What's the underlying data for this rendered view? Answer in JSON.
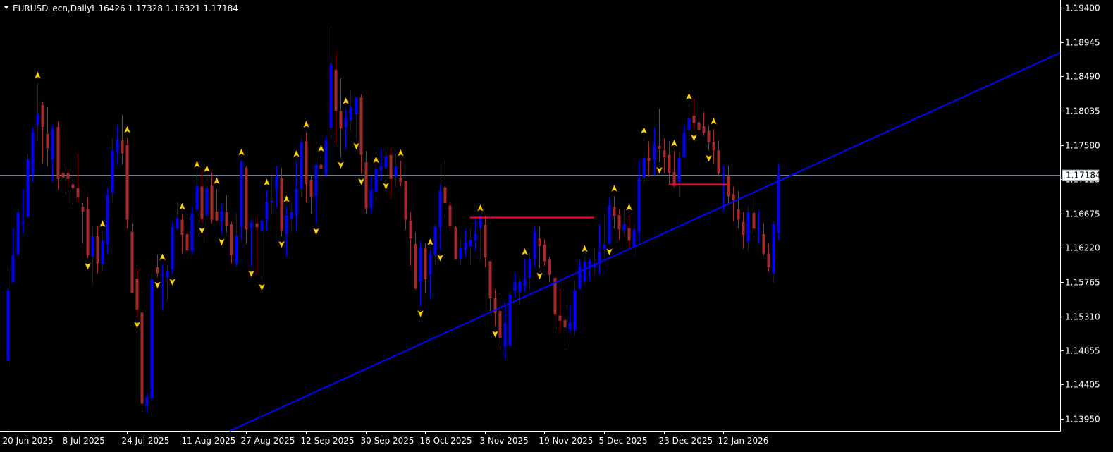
{
  "header": {
    "symbol_timeframe": "EURUSD_ecn,Daily",
    "ohlc_text": "1.16426 1.17328 1.16321 1.17184"
  },
  "current_price_label": "1.17184",
  "colors": {
    "background": "#000000",
    "bull_candle": "#0000ff",
    "bear_candle": "#a52a2a",
    "trendline": "#0000ff",
    "level_lines": "#ff0033",
    "price_line": "#708090",
    "fractal_arrow": "#ffd700",
    "axis": "#ffffff",
    "text": "#ffffff"
  },
  "chart_data": {
    "type": "candlestick",
    "title": "EURUSD_ecn,Daily",
    "y_ticks": [
      "1.19400",
      "1.18945",
      "1.18490",
      "1.18035",
      "1.17580",
      "1.17125",
      "1.16675",
      "1.16220",
      "1.15765",
      "1.15310",
      "1.14855",
      "1.14405",
      "1.13950"
    ],
    "x_labels": [
      {
        "label": "20 Jun 2025",
        "index": 0
      },
      {
        "label": "8 Jul 2025",
        "index": 12
      },
      {
        "label": "24 Jul 2025",
        "index": 24
      },
      {
        "label": "11 Aug 2025",
        "index": 36
      },
      {
        "label": "27 Aug 2025",
        "index": 48
      },
      {
        "label": "12 Sep 2025",
        "index": 60
      },
      {
        "label": "30 Sep 2025",
        "index": 72
      },
      {
        "label": "16 Oct 2025",
        "index": 84
      },
      {
        "label": "3 Nov 2025",
        "index": 96
      },
      {
        "label": "19 Nov 2025",
        "index": 108
      },
      {
        "label": "5 Dec 2025",
        "index": 120
      },
      {
        "label": "23 Dec 2025",
        "index": 132
      },
      {
        "label": "12 Jan 2026",
        "index": 144
      }
    ],
    "ylim": [
      1.1375,
      1.195
    ],
    "current_price": 1.17184,
    "candles": [
      {
        "o": 1.1472,
        "h": 1.1596,
        "l": 1.1464,
        "c": 1.1565
      },
      {
        "o": 1.1576,
        "h": 1.1647,
        "l": 1.1576,
        "c": 1.1612
      },
      {
        "o": 1.1613,
        "h": 1.1681,
        "l": 1.1606,
        "c": 1.1669
      },
      {
        "o": 1.1654,
        "h": 1.17,
        "l": 1.1641,
        "c": 1.1655
      },
      {
        "o": 1.1663,
        "h": 1.1746,
        "l": 1.1662,
        "c": 1.1739
      },
      {
        "o": 1.1719,
        "h": 1.1782,
        "l": 1.171,
        "c": 1.1775
      },
      {
        "o": 1.1785,
        "h": 1.184,
        "l": 1.1764,
        "c": 1.18
      },
      {
        "o": 1.1811,
        "h": 1.1816,
        "l": 1.1734,
        "c": 1.1782
      },
      {
        "o": 1.1773,
        "h": 1.1808,
        "l": 1.173,
        "c": 1.1754
      },
      {
        "o": 1.1739,
        "h": 1.1784,
        "l": 1.171,
        "c": 1.1779
      },
      {
        "o": 1.1782,
        "h": 1.1789,
        "l": 1.1699,
        "c": 1.1713
      },
      {
        "o": 1.1721,
        "h": 1.173,
        "l": 1.1693,
        "c": 1.1715
      },
      {
        "o": 1.1721,
        "h": 1.1724,
        "l": 1.1704,
        "c": 1.1713
      },
      {
        "o": 1.1706,
        "h": 1.1726,
        "l": 1.1679,
        "c": 1.1701
      },
      {
        "o": 1.1701,
        "h": 1.1747,
        "l": 1.1682,
        "c": 1.1688
      },
      {
        "o": 1.1676,
        "h": 1.1681,
        "l": 1.1628,
        "c": 1.167
      },
      {
        "o": 1.1673,
        "h": 1.1688,
        "l": 1.1608,
        "c": 1.1612
      },
      {
        "o": 1.161,
        "h": 1.1651,
        "l": 1.1574,
        "c": 1.1637
      },
      {
        "o": 1.1637,
        "h": 1.1651,
        "l": 1.1588,
        "c": 1.1601
      },
      {
        "o": 1.16,
        "h": 1.1643,
        "l": 1.1591,
        "c": 1.1631
      },
      {
        "o": 1.1627,
        "h": 1.1701,
        "l": 1.1614,
        "c": 1.1692
      },
      {
        "o": 1.1695,
        "h": 1.1767,
        "l": 1.1682,
        "c": 1.1751
      },
      {
        "o": 1.1748,
        "h": 1.1784,
        "l": 1.1732,
        "c": 1.1765
      },
      {
        "o": 1.1764,
        "h": 1.1798,
        "l": 1.1732,
        "c": 1.1747
      },
      {
        "o": 1.1758,
        "h": 1.1768,
        "l": 1.1647,
        "c": 1.1659
      },
      {
        "o": 1.1643,
        "h": 1.1654,
        "l": 1.1565,
        "c": 1.1562
      },
      {
        "o": 1.1581,
        "h": 1.1595,
        "l": 1.153,
        "c": 1.154
      },
      {
        "o": 1.1536,
        "h": 1.1562,
        "l": 1.1408,
        "c": 1.1415
      },
      {
        "o": 1.1412,
        "h": 1.1429,
        "l": 1.1404,
        "c": 1.1424
      },
      {
        "o": 1.1422,
        "h": 1.1588,
        "l": 1.1398,
        "c": 1.158
      },
      {
        "o": 1.1596,
        "h": 1.1613,
        "l": 1.1583,
        "c": 1.1588
      },
      {
        "o": 1.1586,
        "h": 1.1599,
        "l": 1.154,
        "c": 1.1586
      },
      {
        "o": 1.1583,
        "h": 1.1599,
        "l": 1.1551,
        "c": 1.1591
      },
      {
        "o": 1.1593,
        "h": 1.1656,
        "l": 1.1587,
        "c": 1.165
      },
      {
        "o": 1.1647,
        "h": 1.1682,
        "l": 1.1646,
        "c": 1.1661
      },
      {
        "o": 1.1659,
        "h": 1.1666,
        "l": 1.1614,
        "c": 1.1639
      },
      {
        "o": 1.164,
        "h": 1.1662,
        "l": 1.1619,
        "c": 1.1618
      },
      {
        "o": 1.1618,
        "h": 1.1676,
        "l": 1.1614,
        "c": 1.1667
      },
      {
        "o": 1.1672,
        "h": 1.1722,
        "l": 1.1669,
        "c": 1.1703
      },
      {
        "o": 1.1703,
        "h": 1.1724,
        "l": 1.1655,
        "c": 1.166
      },
      {
        "o": 1.1665,
        "h": 1.1716,
        "l": 1.163,
        "c": 1.1701
      },
      {
        "o": 1.1704,
        "h": 1.1721,
        "l": 1.1654,
        "c": 1.1659
      },
      {
        "o": 1.167,
        "h": 1.17,
        "l": 1.1657,
        "c": 1.1658
      },
      {
        "o": 1.1657,
        "h": 1.168,
        "l": 1.164,
        "c": 1.167
      },
      {
        "o": 1.1669,
        "h": 1.1691,
        "l": 1.1642,
        "c": 1.1651
      },
      {
        "o": 1.1653,
        "h": 1.1656,
        "l": 1.1601,
        "c": 1.1612
      },
      {
        "o": 1.16,
        "h": 1.1667,
        "l": 1.1597,
        "c": 1.1638
      },
      {
        "o": 1.165,
        "h": 1.1738,
        "l": 1.1632,
        "c": 1.1736
      },
      {
        "o": 1.1728,
        "h": 1.173,
        "l": 1.1627,
        "c": 1.1646
      },
      {
        "o": 1.1648,
        "h": 1.1658,
        "l": 1.1598,
        "c": 1.1655
      },
      {
        "o": 1.1654,
        "h": 1.1663,
        "l": 1.1586,
        "c": 1.1649
      },
      {
        "o": 1.1644,
        "h": 1.1658,
        "l": 1.158,
        "c": 1.1658
      },
      {
        "o": 1.166,
        "h": 1.1698,
        "l": 1.1645,
        "c": 1.1682
      },
      {
        "o": 1.1682,
        "h": 1.1716,
        "l": 1.1667,
        "c": 1.1684
      },
      {
        "o": 1.17,
        "h": 1.173,
        "l": 1.1675,
        "c": 1.1717
      },
      {
        "o": 1.1714,
        "h": 1.1728,
        "l": 1.1637,
        "c": 1.1644
      },
      {
        "o": 1.164,
        "h": 1.1676,
        "l": 1.161,
        "c": 1.1665
      },
      {
        "o": 1.166,
        "h": 1.168,
        "l": 1.1643,
        "c": 1.1669
      },
      {
        "o": 1.1665,
        "h": 1.1736,
        "l": 1.1645,
        "c": 1.17
      },
      {
        "o": 1.17,
        "h": 1.1767,
        "l": 1.1689,
        "c": 1.1762
      },
      {
        "o": 1.1763,
        "h": 1.1775,
        "l": 1.1682,
        "c": 1.1706
      },
      {
        "o": 1.1712,
        "h": 1.1718,
        "l": 1.1667,
        "c": 1.1689
      },
      {
        "o": 1.169,
        "h": 1.1733,
        "l": 1.1654,
        "c": 1.1732
      },
      {
        "o": 1.1732,
        "h": 1.1743,
        "l": 1.1716,
        "c": 1.1726
      },
      {
        "o": 1.1719,
        "h": 1.177,
        "l": 1.1716,
        "c": 1.1764
      },
      {
        "o": 1.1781,
        "h": 1.1914,
        "l": 1.1767,
        "c": 1.1865
      },
      {
        "o": 1.1858,
        "h": 1.1883,
        "l": 1.1761,
        "c": 1.1803
      },
      {
        "o": 1.1803,
        "h": 1.1847,
        "l": 1.1742,
        "c": 1.178
      },
      {
        "o": 1.1782,
        "h": 1.1806,
        "l": 1.1753,
        "c": 1.1793
      },
      {
        "o": 1.1791,
        "h": 1.1831,
        "l": 1.1776,
        "c": 1.1808
      },
      {
        "o": 1.1799,
        "h": 1.1822,
        "l": 1.1767,
        "c": 1.1821
      },
      {
        "o": 1.1821,
        "h": 1.1825,
        "l": 1.172,
        "c": 1.1745
      },
      {
        "o": 1.1735,
        "h": 1.175,
        "l": 1.1667,
        "c": 1.1674
      },
      {
        "o": 1.1675,
        "h": 1.1717,
        "l": 1.1667,
        "c": 1.1699
      },
      {
        "o": 1.1696,
        "h": 1.1728,
        "l": 1.1685,
        "c": 1.1726
      },
      {
        "o": 1.1724,
        "h": 1.1753,
        "l": 1.1712,
        "c": 1.173
      },
      {
        "o": 1.1728,
        "h": 1.1756,
        "l": 1.1714,
        "c": 1.1743
      },
      {
        "o": 1.1745,
        "h": 1.1754,
        "l": 1.1688,
        "c": 1.1713
      },
      {
        "o": 1.1716,
        "h": 1.1746,
        "l": 1.1702,
        "c": 1.173
      },
      {
        "o": 1.1714,
        "h": 1.1737,
        "l": 1.1703,
        "c": 1.1709
      },
      {
        "o": 1.1711,
        "h": 1.1711,
        "l": 1.1646,
        "c": 1.1659
      },
      {
        "o": 1.1658,
        "h": 1.1669,
        "l": 1.1598,
        "c": 1.1634
      },
      {
        "o": 1.1627,
        "h": 1.1642,
        "l": 1.1566,
        "c": 1.1568
      },
      {
        "o": 1.1577,
        "h": 1.163,
        "l": 1.1545,
        "c": 1.1622
      },
      {
        "o": 1.1621,
        "h": 1.1628,
        "l": 1.1561,
        "c": 1.158
      },
      {
        "o": 1.1586,
        "h": 1.1619,
        "l": 1.1555,
        "c": 1.1614
      },
      {
        "o": 1.1612,
        "h": 1.1652,
        "l": 1.1599,
        "c": 1.165
      },
      {
        "o": 1.1649,
        "h": 1.1705,
        "l": 1.1619,
        "c": 1.1697
      },
      {
        "o": 1.1702,
        "h": 1.1738,
        "l": 1.1661,
        "c": 1.1681
      },
      {
        "o": 1.1678,
        "h": 1.1682,
        "l": 1.1647,
        "c": 1.1651
      },
      {
        "o": 1.1649,
        "h": 1.1651,
        "l": 1.1606,
        "c": 1.1606
      },
      {
        "o": 1.1606,
        "h": 1.1633,
        "l": 1.1599,
        "c": 1.1621
      },
      {
        "o": 1.162,
        "h": 1.1646,
        "l": 1.161,
        "c": 1.1629
      },
      {
        "o": 1.1624,
        "h": 1.1648,
        "l": 1.1599,
        "c": 1.1632
      },
      {
        "o": 1.1631,
        "h": 1.166,
        "l": 1.1618,
        "c": 1.164
      },
      {
        "o": 1.1648,
        "h": 1.1664,
        "l": 1.1604,
        "c": 1.1664
      },
      {
        "o": 1.1652,
        "h": 1.1664,
        "l": 1.1596,
        "c": 1.1609
      },
      {
        "o": 1.1604,
        "h": 1.1604,
        "l": 1.1538,
        "c": 1.1555
      },
      {
        "o": 1.1555,
        "h": 1.1567,
        "l": 1.1518,
        "c": 1.1535
      },
      {
        "o": 1.1538,
        "h": 1.1556,
        "l": 1.1489,
        "c": 1.1502
      },
      {
        "o": 1.1491,
        "h": 1.155,
        "l": 1.1474,
        "c": 1.1522
      },
      {
        "o": 1.1493,
        "h": 1.1563,
        "l": 1.1491,
        "c": 1.156
      },
      {
        "o": 1.1565,
        "h": 1.1589,
        "l": 1.1556,
        "c": 1.1576
      },
      {
        "o": 1.1563,
        "h": 1.1581,
        "l": 1.1547,
        "c": 1.1577
      },
      {
        "o": 1.1571,
        "h": 1.1606,
        "l": 1.1563,
        "c": 1.158
      },
      {
        "o": 1.1582,
        "h": 1.1615,
        "l": 1.1566,
        "c": 1.1606
      },
      {
        "o": 1.1607,
        "h": 1.165,
        "l": 1.1596,
        "c": 1.1643
      },
      {
        "o": 1.1634,
        "h": 1.165,
        "l": 1.1595,
        "c": 1.1624
      },
      {
        "o": 1.1626,
        "h": 1.1633,
        "l": 1.1598,
        "c": 1.1604
      },
      {
        "o": 1.1606,
        "h": 1.161,
        "l": 1.1576,
        "c": 1.1586
      },
      {
        "o": 1.1582,
        "h": 1.1582,
        "l": 1.1514,
        "c": 1.1533
      },
      {
        "o": 1.1532,
        "h": 1.1568,
        "l": 1.1509,
        "c": 1.1525
      },
      {
        "o": 1.1526,
        "h": 1.1543,
        "l": 1.1491,
        "c": 1.1516
      },
      {
        "o": 1.1514,
        "h": 1.1546,
        "l": 1.1509,
        "c": 1.1523
      },
      {
        "o": 1.1512,
        "h": 1.1578,
        "l": 1.1506,
        "c": 1.1566
      },
      {
        "o": 1.1567,
        "h": 1.1605,
        "l": 1.1567,
        "c": 1.1597
      },
      {
        "o": 1.1577,
        "h": 1.161,
        "l": 1.1573,
        "c": 1.1604
      },
      {
        "o": 1.1596,
        "h": 1.1608,
        "l": 1.1578,
        "c": 1.1604
      },
      {
        "o": 1.1596,
        "h": 1.1621,
        "l": 1.1586,
        "c": 1.1601
      },
      {
        "o": 1.1601,
        "h": 1.1653,
        "l": 1.1587,
        "c": 1.1616
      },
      {
        "o": 1.162,
        "h": 1.1665,
        "l": 1.1608,
        "c": 1.1626
      },
      {
        "o": 1.1627,
        "h": 1.1688,
        "l": 1.1627,
        "c": 1.1678
      },
      {
        "o": 1.1676,
        "h": 1.169,
        "l": 1.1647,
        "c": 1.1664
      },
      {
        "o": 1.1665,
        "h": 1.1673,
        "l": 1.1632,
        "c": 1.1646
      },
      {
        "o": 1.1645,
        "h": 1.1674,
        "l": 1.1638,
        "c": 1.1653
      },
      {
        "o": 1.1648,
        "h": 1.1665,
        "l": 1.162,
        "c": 1.1631
      },
      {
        "o": 1.1624,
        "h": 1.1652,
        "l": 1.1613,
        "c": 1.1646
      },
      {
        "o": 1.1643,
        "h": 1.1737,
        "l": 1.163,
        "c": 1.1714
      },
      {
        "o": 1.1715,
        "h": 1.1767,
        "l": 1.1708,
        "c": 1.1741
      },
      {
        "o": 1.1741,
        "h": 1.1763,
        "l": 1.1716,
        "c": 1.1737
      },
      {
        "o": 1.1738,
        "h": 1.1781,
        "l": 1.1718,
        "c": 1.1758
      },
      {
        "o": 1.1757,
        "h": 1.1806,
        "l": 1.1735,
        "c": 1.1753
      },
      {
        "o": 1.1751,
        "h": 1.1767,
        "l": 1.1721,
        "c": 1.1742
      },
      {
        "o": 1.1745,
        "h": 1.1763,
        "l": 1.1705,
        "c": 1.1721
      },
      {
        "o": 1.1722,
        "h": 1.175,
        "l": 1.1702,
        "c": 1.1704
      },
      {
        "o": 1.1709,
        "h": 1.1749,
        "l": 1.1689,
        "c": 1.1741
      },
      {
        "o": 1.1742,
        "h": 1.1785,
        "l": 1.1742,
        "c": 1.1774
      },
      {
        "o": 1.1778,
        "h": 1.1812,
        "l": 1.1773,
        "c": 1.1793
      },
      {
        "o": 1.1797,
        "h": 1.1819,
        "l": 1.1778,
        "c": 1.1787
      },
      {
        "o": 1.1788,
        "h": 1.18,
        "l": 1.1772,
        "c": 1.1778
      },
      {
        "o": 1.1783,
        "h": 1.1802,
        "l": 1.177,
        "c": 1.1774
      },
      {
        "o": 1.1777,
        "h": 1.1784,
        "l": 1.1751,
        "c": 1.1762
      },
      {
        "o": 1.1762,
        "h": 1.1779,
        "l": 1.1733,
        "c": 1.1751
      },
      {
        "o": 1.1751,
        "h": 1.1764,
        "l": 1.1716,
        "c": 1.172
      },
      {
        "o": 1.1718,
        "h": 1.1731,
        "l": 1.1671,
        "c": 1.1719
      },
      {
        "o": 1.1717,
        "h": 1.1731,
        "l": 1.1678,
        "c": 1.169
      },
      {
        "o": 1.1693,
        "h": 1.1703,
        "l": 1.1657,
        "c": 1.1685
      },
      {
        "o": 1.1673,
        "h": 1.1697,
        "l": 1.1647,
        "c": 1.1659
      },
      {
        "o": 1.1656,
        "h": 1.1669,
        "l": 1.162,
        "c": 1.1639
      },
      {
        "o": 1.163,
        "h": 1.1676,
        "l": 1.1617,
        "c": 1.1669
      },
      {
        "o": 1.1668,
        "h": 1.1693,
        "l": 1.1641,
        "c": 1.1647
      },
      {
        "o": 1.1648,
        "h": 1.1671,
        "l": 1.1628,
        "c": 1.1648
      },
      {
        "o": 1.164,
        "h": 1.1654,
        "l": 1.1612,
        "c": 1.1614
      },
      {
        "o": 1.1614,
        "h": 1.1628,
        "l": 1.159,
        "c": 1.1596
      },
      {
        "o": 1.1588,
        "h": 1.1657,
        "l": 1.1575,
        "c": 1.1653
      },
      {
        "o": 1.16426,
        "h": 1.17328,
        "l": 1.16321,
        "c": 1.17184
      }
    ],
    "annotations": {
      "trendline": {
        "start": {
          "index": 45,
          "price": 1.138
        },
        "end": {
          "index": 171,
          "price": 1.1758
        }
      },
      "levels": [
        {
          "price": 1.1662,
          "from_index": 93,
          "to_index": 118
        },
        {
          "price": 1.1706,
          "from_index": 133,
          "to_index": 145
        }
      ],
      "fractals_up": [
        6,
        19,
        24,
        31,
        35,
        38,
        40,
        42,
        47,
        52,
        56,
        58,
        60,
        63,
        68,
        74,
        79,
        85,
        95,
        104,
        116,
        122,
        125,
        128,
        134,
        137,
        142
      ],
      "fractals_down": [
        16,
        26,
        30,
        33,
        39,
        43,
        49,
        51,
        55,
        62,
        67,
        70,
        71,
        76,
        83,
        87,
        98,
        107,
        121,
        131,
        138,
        141
      ]
    }
  }
}
